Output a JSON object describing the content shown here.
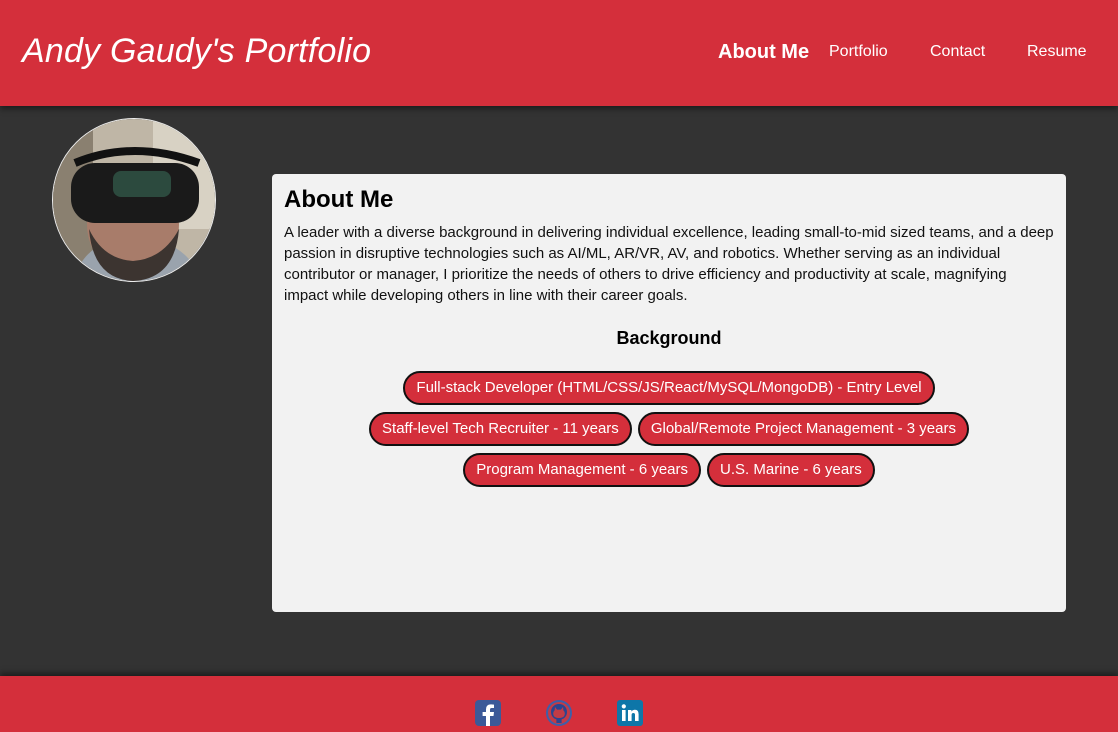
{
  "header": {
    "site_title": "Andy Gaudy's Portfolio",
    "nav": [
      {
        "label": "About Me",
        "active": true
      },
      {
        "label": "Portfolio"
      },
      {
        "label": "Contact"
      },
      {
        "label": "Resume"
      }
    ]
  },
  "profile": {
    "avatar_icon": "profile-photo-vr-headset"
  },
  "about": {
    "heading": "About Me",
    "bio": "A leader with a diverse background in delivering individual excellence, leading small-to-mid sized teams, and a deep passion in disruptive technologies such as AI/ML, AR/VR, AV, and robotics. Whether serving as an individual contributor or manager, I prioritize the needs of others to drive efficiency and productivity at scale, magnifying impact while developing others in line with their career goals.",
    "background_heading": "Background",
    "badges": [
      "Full-stack Developer (HTML/CSS/JS/React/MySQL/MongoDB) - Entry Level",
      "Staff-level Tech Recruiter - 11 years",
      "Global/Remote Project Management - 3 years",
      "Program Management - 6 years",
      "U.S. Marine - 6 years"
    ]
  },
  "footer": {
    "social": [
      {
        "icon": "facebook-icon",
        "color": "#3b5998"
      },
      {
        "icon": "github-icon",
        "color": "#2f4a9a"
      },
      {
        "icon": "linkedin-icon",
        "color": "#0e76a8"
      }
    ]
  },
  "colors": {
    "brand_red": "#d42f3b",
    "background": "#333333",
    "card": "#f2f2f2"
  }
}
